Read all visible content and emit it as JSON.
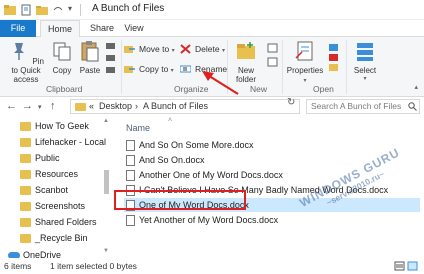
{
  "window": {
    "title": "A Bunch of Files"
  },
  "tabs": [
    {
      "label": "File"
    },
    {
      "label": "Home"
    },
    {
      "label": "Share"
    },
    {
      "label": "View"
    }
  ],
  "ribbon": {
    "clipboard": {
      "pin_label": "Pin to Quick access",
      "copy_label": "Copy",
      "paste_label": "Paste",
      "group_label": "Clipboard"
    },
    "organize": {
      "move_to_label": "Move to",
      "copy_to_label": "Copy to",
      "delete_label": "Delete",
      "rename_label": "Rename",
      "group_label": "Organize"
    },
    "new": {
      "new_folder_label": "New folder",
      "group_label": "New"
    },
    "open": {
      "properties_label": "Properties",
      "group_label": "Open"
    },
    "select": {
      "select_label": "Select"
    }
  },
  "address": {
    "prefix": "«",
    "crumb1": "Desktop",
    "sep": "›",
    "crumb2": "A Bunch of Files",
    "search_placeholder": "Search A Bunch of Files"
  },
  "nav_pane": {
    "items": [
      {
        "label": "How To Geek"
      },
      {
        "label": "Lifehacker - Local"
      },
      {
        "label": "Public"
      },
      {
        "label": "Resources"
      },
      {
        "label": "Scanbot"
      },
      {
        "label": "Screenshots"
      },
      {
        "label": "Shared Folders"
      },
      {
        "label": "_Recycle Bin"
      }
    ],
    "onedrive": "OneDrive"
  },
  "file_list": {
    "column_name": "Name",
    "files": [
      {
        "name": "And So On Some More.docx"
      },
      {
        "name": "And So On.docx"
      },
      {
        "name": "Another One of My Word Docs.docx"
      },
      {
        "name": "I Can't Believe I Have So Many Badly Named Word Docs.docx"
      },
      {
        "name": "One of My Word Docs.docx"
      },
      {
        "name": "Yet Another of My Word Docs.docx"
      }
    ]
  },
  "status": {
    "items_count": "6 items",
    "selection": "1 item selected  0 bytes"
  },
  "watermark": {
    "line1": "WINDOWS GURU",
    "line2": "~servis2010.ru~"
  },
  "colors": {
    "accent": "#1979ca",
    "selection": "#cce8ff",
    "highlight": "#e02020",
    "folder": "#e8c050"
  }
}
